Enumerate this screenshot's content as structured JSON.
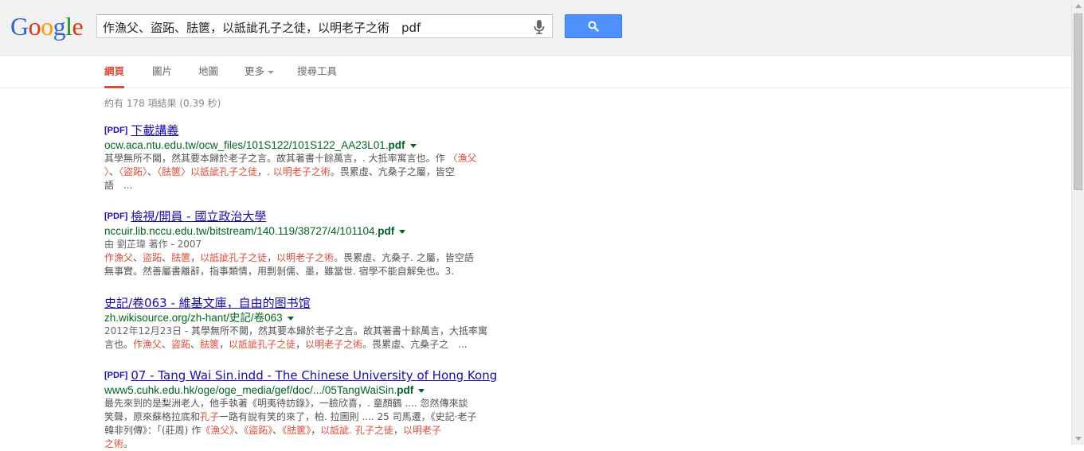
{
  "logo": {
    "letters": [
      "G",
      "o",
      "o",
      "g",
      "l",
      "e"
    ],
    "colors": [
      "#3366cc",
      "#dc3912",
      "#ff9900",
      "#3366cc",
      "#109618",
      "#dc3912"
    ]
  },
  "search": {
    "query": "作漁父、盜跖、胠篋，以詆訿孔子之徒，以明老子之術　pdf",
    "button_icon": "search-icon",
    "mic_icon": "microphone-icon"
  },
  "nav": {
    "tabs": [
      {
        "label": "網頁",
        "active": true
      },
      {
        "label": "圖片",
        "active": false
      },
      {
        "label": "地圖",
        "active": false
      },
      {
        "label": "更多",
        "active": false
      },
      {
        "label": "搜尋工具",
        "active": false
      }
    ]
  },
  "stats": "約有 178 項結果 (0.39 秒)",
  "results": [
    {
      "filetype": "[PDF]",
      "title": "下載講義",
      "url_prefix": "ocw.aca.ntu.edu.tw/ocw_files/101S122/101S122_AA23L01.",
      "url_bold": "pdf",
      "meta": "",
      "snippet": [
        {
          "t": "其學無所不闚，然其要本歸於老子之言。故其著書十餘萬言，. 大抵率寓言也。作 "
        },
        {
          "t": "〈漁父\n〉",
          "hl": true
        },
        {
          "t": "、"
        },
        {
          "t": "〈盜跖〉",
          "hl": true
        },
        {
          "t": "、"
        },
        {
          "t": "〈胠篋〉以詆訿孔子之徒",
          "hl": true
        },
        {
          "t": "，. "
        },
        {
          "t": "以明老子之術",
          "hl": true
        },
        {
          "t": "。畏累虛、亢桑子之屬，皆空\n語　..."
        }
      ]
    },
    {
      "filetype": "[PDF]",
      "title": "檢視/開員 - 國立政治大學",
      "url_prefix": "nccuir.lib.nccu.edu.tw/bitstream/140.119/38727/4/101104.",
      "url_bold": "pdf",
      "meta": "由 劉芷瑋 著作 - 2007",
      "snippet": [
        {
          "t": "作漁父",
          "hl": true
        },
        {
          "t": "、"
        },
        {
          "t": "盜跖",
          "hl": true
        },
        {
          "t": "、"
        },
        {
          "t": "胠篋",
          "hl": true
        },
        {
          "t": "，"
        },
        {
          "t": "以詆訿孔子之徒",
          "hl": true
        },
        {
          "t": "，"
        },
        {
          "t": "以明老子之術",
          "hl": true
        },
        {
          "t": "。畏累虛、亢桑子. 之屬，皆空語\n無事實。然善屬書離辭，指事類情，用剽剝儒、墨，雖當世. 宿學不能自解免也。3."
        }
      ]
    },
    {
      "filetype": "",
      "title": "史記/卷063 - 維基文庫，自由的图书馆",
      "url_prefix": "zh.wikisource.org/zh-hant/史記/卷063",
      "url_bold": "",
      "meta": "",
      "snippet": [
        {
          "t": "2012年12月23日 - ",
          "date": true
        },
        {
          "t": "其學無所不闚，然其要本歸於老子之言。故其著書十餘萬言，大抵率寓\n言也。"
        },
        {
          "t": "作漁父",
          "hl": true
        },
        {
          "t": "、"
        },
        {
          "t": "盜跖",
          "hl": true
        },
        {
          "t": "、"
        },
        {
          "t": "胠篋",
          "hl": true
        },
        {
          "t": "，"
        },
        {
          "t": "以詆訿孔子之徒",
          "hl": true
        },
        {
          "t": "，"
        },
        {
          "t": "以明老子之術",
          "hl": true
        },
        {
          "t": "。畏累虛、亢桑子之　..."
        }
      ]
    },
    {
      "filetype": "[PDF]",
      "title": "07 - Tang Wai Sin.indd - The Chinese University of Hong Kong",
      "url_prefix": "www5.cuhk.edu.hk/oge/oge_media/gef/doc/.../05TangWaiSin.",
      "url_bold": "pdf",
      "meta": "",
      "snippet": [
        {
          "t": "最先來到的是梨洲老人，他手執著《明夷待訪錄》，一臉欣喜，. 童顏鶴 .... 忽然傳來談\n笑聲，原來蘇格拉底和"
        },
        {
          "t": "孔子",
          "hl": true
        },
        {
          "t": "一路有說有笑的來了，柏. 拉圖則 .... 25 司馬遷，《史記·老子\n韓非列傳》：「(莊周) "
        },
        {
          "t": "作",
          "plain": true
        },
        {
          "t": "《漁父》",
          "hl": true
        },
        {
          "t": "、"
        },
        {
          "t": "《盜跖》",
          "hl": true
        },
        {
          "t": "、"
        },
        {
          "t": "《胠篋》",
          "hl": true
        },
        {
          "t": "，"
        },
        {
          "t": "以詆訿. 孔子之徒",
          "hl": true
        },
        {
          "t": "，"
        },
        {
          "t": "以明老子",
          "hl": true
        },
        {
          "t": "\n"
        },
        {
          "t": "之術",
          "hl": true
        },
        {
          "t": "。"
        }
      ]
    }
  ]
}
